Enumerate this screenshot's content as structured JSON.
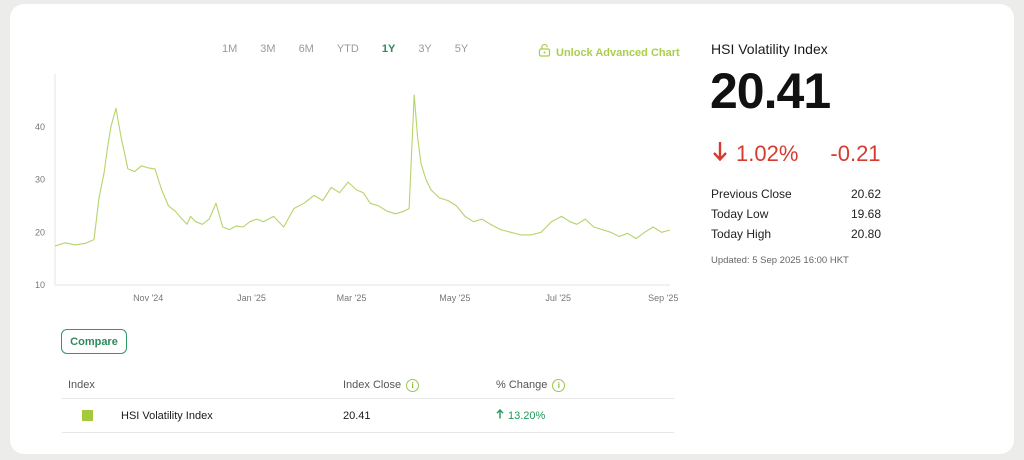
{
  "ranges": [
    {
      "label": "1M",
      "active": false
    },
    {
      "label": "3M",
      "active": false
    },
    {
      "label": "6M",
      "active": false
    },
    {
      "label": "YTD",
      "active": false
    },
    {
      "label": "1Y",
      "active": true
    },
    {
      "label": "3Y",
      "active": false
    },
    {
      "label": "5Y",
      "active": false
    }
  ],
  "unlock": {
    "label": "Unlock Advanced Chart",
    "icon": "lock-icon"
  },
  "chart_data": {
    "type": "line",
    "xlabel": "",
    "ylabel": "",
    "ylim": [
      10,
      50
    ],
    "yticks": [
      10,
      20,
      30,
      40
    ],
    "xlim": [
      "2024-09-07",
      "2025-09-05"
    ],
    "xticks": [
      {
        "date": "2024-11-01",
        "label": "Nov '24"
      },
      {
        "date": "2025-01-01",
        "label": "Jan '25"
      },
      {
        "date": "2025-03-01",
        "label": "Mar '25"
      },
      {
        "date": "2025-05-01",
        "label": "May '25"
      },
      {
        "date": "2025-07-01",
        "label": "Jul '25"
      },
      {
        "date": "2025-09-01",
        "label": "Sep '25"
      }
    ],
    "grid": false,
    "color": "#b5d36b",
    "series": [
      {
        "x": [
          "2024-09-07",
          "2024-09-13",
          "2024-09-19",
          "2024-09-25",
          "2024-09-30",
          "2024-10-03",
          "2024-10-06",
          "2024-10-08",
          "2024-10-10",
          "2024-10-13",
          "2024-10-16",
          "2024-10-20",
          "2024-10-24",
          "2024-10-28",
          "2024-11-01",
          "2024-11-05",
          "2024-11-09",
          "2024-11-13",
          "2024-11-17",
          "2024-11-21",
          "2024-11-24",
          "2024-11-26",
          "2024-11-29",
          "2024-12-03",
          "2024-12-07",
          "2024-12-11",
          "2024-12-15",
          "2024-12-19",
          "2024-12-23",
          "2024-12-27",
          "2024-12-31",
          "2025-01-04",
          "2025-01-08",
          "2025-01-14",
          "2025-01-20",
          "2025-01-26",
          "2025-02-01",
          "2025-02-07",
          "2025-02-12",
          "2025-02-17",
          "2025-02-22",
          "2025-02-27",
          "2025-03-04",
          "2025-03-08",
          "2025-03-12",
          "2025-03-17",
          "2025-03-22",
          "2025-03-27",
          "2025-04-01",
          "2025-04-04",
          "2025-04-07",
          "2025-04-09",
          "2025-04-11",
          "2025-04-14",
          "2025-04-17",
          "2025-04-22",
          "2025-04-27",
          "2025-05-02",
          "2025-05-07",
          "2025-05-12",
          "2025-05-17",
          "2025-05-22",
          "2025-05-28",
          "2025-06-03",
          "2025-06-09",
          "2025-06-15",
          "2025-06-21",
          "2025-06-27",
          "2025-07-03",
          "2025-07-08",
          "2025-07-12",
          "2025-07-17",
          "2025-07-22",
          "2025-07-27",
          "2025-08-01",
          "2025-08-06",
          "2025-08-11",
          "2025-08-16",
          "2025-08-21",
          "2025-08-26",
          "2025-08-31",
          "2025-09-05"
        ],
        "y": [
          17.4,
          18.0,
          17.6,
          17.9,
          18.6,
          26.5,
          31.3,
          36.0,
          40.0,
          43.5,
          38.0,
          32.0,
          31.5,
          32.6,
          32.2,
          32.0,
          28.0,
          25.0,
          24.0,
          22.5,
          21.5,
          23.0,
          22.0,
          21.5,
          22.5,
          25.5,
          21.0,
          20.5,
          21.2,
          21.0,
          22.0,
          22.5,
          22.0,
          23.0,
          21.0,
          24.5,
          25.5,
          27.0,
          26.0,
          28.5,
          27.5,
          29.5,
          28.0,
          27.5,
          25.5,
          25.0,
          24.0,
          23.5,
          24.0,
          24.5,
          46.0,
          38.0,
          33.0,
          30.0,
          28.0,
          26.5,
          26.0,
          25.0,
          23.0,
          22.0,
          22.5,
          21.5,
          20.5,
          20.0,
          19.5,
          19.5,
          20.0,
          22.0,
          23.0,
          22.0,
          21.5,
          22.5,
          21.0,
          20.5,
          20.0,
          19.2,
          19.8,
          18.8,
          20.0,
          21.0,
          20.0,
          20.41
        ]
      }
    ]
  },
  "compare_label": "Compare",
  "table": {
    "headers": {
      "index": "Index",
      "close": "Index Close",
      "change": "% Change"
    },
    "rows": [
      {
        "name": "HSI Volatility Index",
        "close": "20.41",
        "change": "13.20%",
        "color": "#a5c93c"
      }
    ]
  },
  "summary": {
    "title": "HSI Volatility Index",
    "value": "20.41",
    "change_pct": "1.02%",
    "change_abs": "-0.21",
    "direction": "down",
    "stats": [
      {
        "label": "Previous Close",
        "value": "20.62"
      },
      {
        "label": "Today Low",
        "value": "19.68"
      },
      {
        "label": "Today High",
        "value": "20.80"
      }
    ],
    "updated": "Updated: 5 Sep 2025 16:00 HKT"
  },
  "colors": {
    "accent": "#2e9a66",
    "line": "#b5d36b",
    "negative": "#d63b30",
    "positive": "#1f9a55"
  }
}
